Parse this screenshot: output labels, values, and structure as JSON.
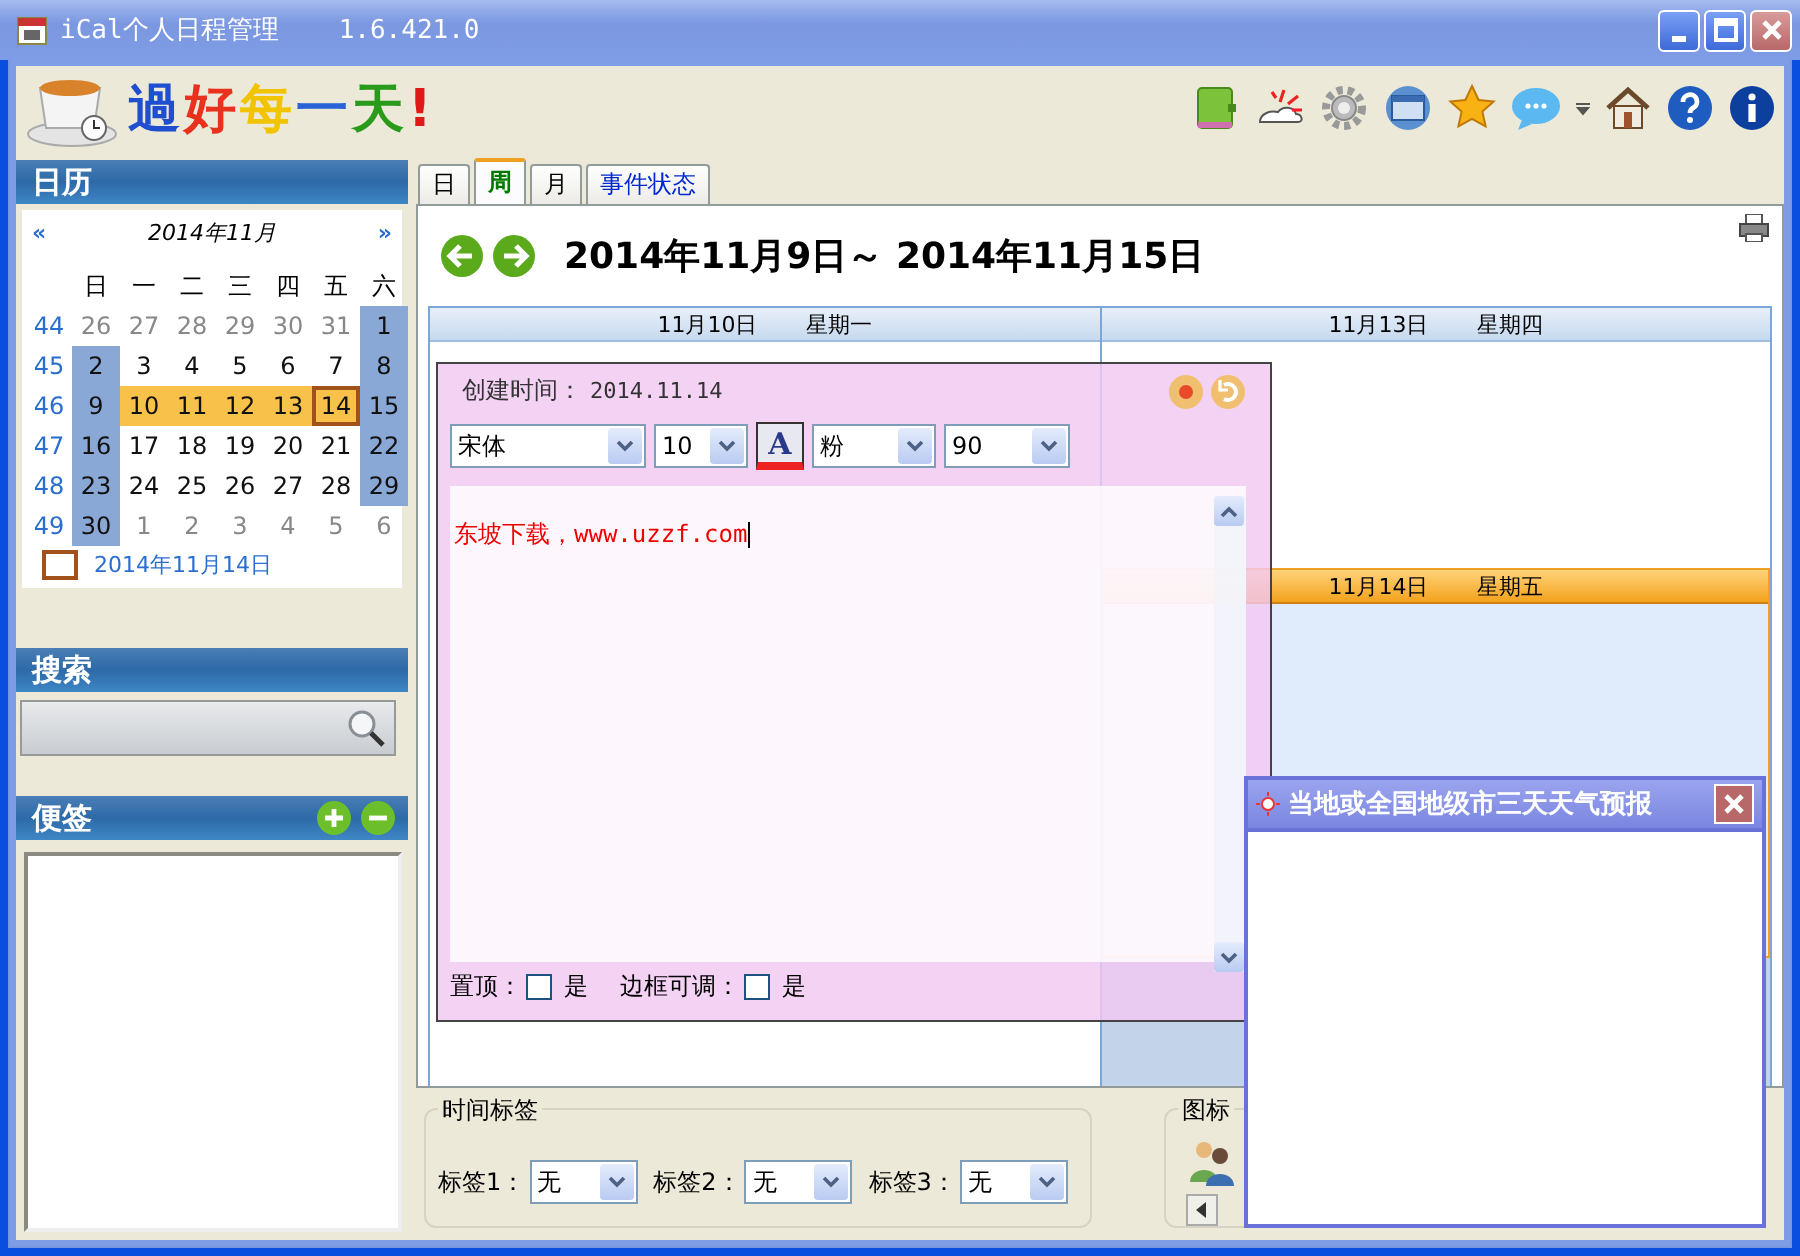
{
  "window": {
    "title": "iCal个人日程管理",
    "version": "1.6.421.0"
  },
  "logo": {
    "text": "過好每一天!"
  },
  "sidebar": {
    "calendar": {
      "title": "日历",
      "prev": "«",
      "month": "2014年11月",
      "next": "»",
      "weekdays": [
        "日",
        "一",
        "二",
        "三",
        "四",
        "五",
        "六"
      ],
      "weeks": [
        {
          "week": "44",
          "days": [
            {
              "day": "26",
              "kind": "other",
              "today": false
            },
            {
              "day": "27",
              "kind": "other",
              "today": false
            },
            {
              "day": "28",
              "kind": "other",
              "today": false
            },
            {
              "day": "29",
              "kind": "other",
              "today": false
            },
            {
              "day": "30",
              "kind": "other",
              "today": false
            },
            {
              "day": "31",
              "kind": "other",
              "today": false
            },
            {
              "day": "1",
              "kind": "weekend",
              "today": false
            }
          ]
        },
        {
          "week": "45",
          "days": [
            {
              "day": "2",
              "kind": "weekend",
              "today": false
            },
            {
              "day": "3",
              "kind": "plain",
              "today": false
            },
            {
              "day": "4",
              "kind": "plain",
              "today": false
            },
            {
              "day": "5",
              "kind": "plain",
              "today": false
            },
            {
              "day": "6",
              "kind": "plain",
              "today": false
            },
            {
              "day": "7",
              "kind": "plain",
              "today": false
            },
            {
              "day": "8",
              "kind": "weekend",
              "today": false
            }
          ]
        },
        {
          "week": "46",
          "days": [
            {
              "day": "9",
              "kind": "weekend",
              "today": false
            },
            {
              "day": "10",
              "kind": "week",
              "today": false
            },
            {
              "day": "11",
              "kind": "week",
              "today": false
            },
            {
              "day": "12",
              "kind": "week",
              "today": false
            },
            {
              "day": "13",
              "kind": "week",
              "today": false
            },
            {
              "day": "14",
              "kind": "week",
              "today": true
            },
            {
              "day": "15",
              "kind": "weekend",
              "today": false
            }
          ]
        },
        {
          "week": "47",
          "days": [
            {
              "day": "16",
              "kind": "weekend",
              "today": false
            },
            {
              "day": "17",
              "kind": "plain",
              "today": false
            },
            {
              "day": "18",
              "kind": "plain",
              "today": false
            },
            {
              "day": "19",
              "kind": "plain",
              "today": false
            },
            {
              "day": "20",
              "kind": "plain",
              "today": false
            },
            {
              "day": "21",
              "kind": "plain",
              "today": false
            },
            {
              "day": "22",
              "kind": "weekend",
              "today": false
            }
          ]
        },
        {
          "week": "48",
          "days": [
            {
              "day": "23",
              "kind": "weekend",
              "today": false
            },
            {
              "day": "24",
              "kind": "plain",
              "today": false
            },
            {
              "day": "25",
              "kind": "plain",
              "today": false
            },
            {
              "day": "26",
              "kind": "plain",
              "today": false
            },
            {
              "day": "27",
              "kind": "plain",
              "today": false
            },
            {
              "day": "28",
              "kind": "plain",
              "today": false
            },
            {
              "day": "29",
              "kind": "weekend",
              "today": false
            }
          ]
        },
        {
          "week": "49",
          "days": [
            {
              "day": "30",
              "kind": "weekend",
              "today": false
            },
            {
              "day": "1",
              "kind": "other",
              "today": false
            },
            {
              "day": "2",
              "kind": "other",
              "today": false
            },
            {
              "day": "3",
              "kind": "other",
              "today": false
            },
            {
              "day": "4",
              "kind": "other",
              "today": false
            },
            {
              "day": "5",
              "kind": "other",
              "today": false
            },
            {
              "day": "6",
              "kind": "other",
              "today": false
            }
          ]
        }
      ],
      "today_label": "2014年11月14日"
    },
    "search": {
      "title": "搜索"
    },
    "notes": {
      "title": "便签"
    }
  },
  "tabs": [
    {
      "label": "日",
      "selected": false,
      "kind": "view"
    },
    {
      "label": "周",
      "selected": true,
      "kind": "view"
    },
    {
      "label": "月",
      "selected": false,
      "kind": "view"
    },
    {
      "label": "事件状态",
      "selected": false,
      "kind": "link"
    }
  ],
  "week_view": {
    "range": "2014年11月9日～ 2014年11月15日",
    "columns": [
      [
        {
          "date": "11月10日",
          "weekday": "星期一",
          "selected": false
        }
      ],
      [
        {
          "date": "11月13日",
          "weekday": "星期四",
          "selected": false
        },
        {
          "date": "11月14日",
          "weekday": "星期五",
          "selected": true
        }
      ]
    ]
  },
  "note_popup": {
    "created_label": "创建时间：",
    "created": "2014.11.14",
    "font": "宋体",
    "size": "10",
    "color_name": "粉",
    "opacity": "90",
    "color_button": "A",
    "text": "东坡下载，www.uzzf.com",
    "options": [
      {
        "label": "置顶：",
        "value": "是",
        "checked": false
      },
      {
        "label": "边框可调：",
        "value": "是",
        "checked": false
      }
    ]
  },
  "time_tags": {
    "title": "时间标签",
    "tags": [
      {
        "label": "标签1：",
        "value": "无"
      },
      {
        "label": "标签2：",
        "value": "无"
      },
      {
        "label": "标签3：",
        "value": "无"
      }
    ]
  },
  "icon_tags": {
    "title": "图标"
  },
  "weather_popup": {
    "title": "当地或全国地级市三天天气预报"
  }
}
